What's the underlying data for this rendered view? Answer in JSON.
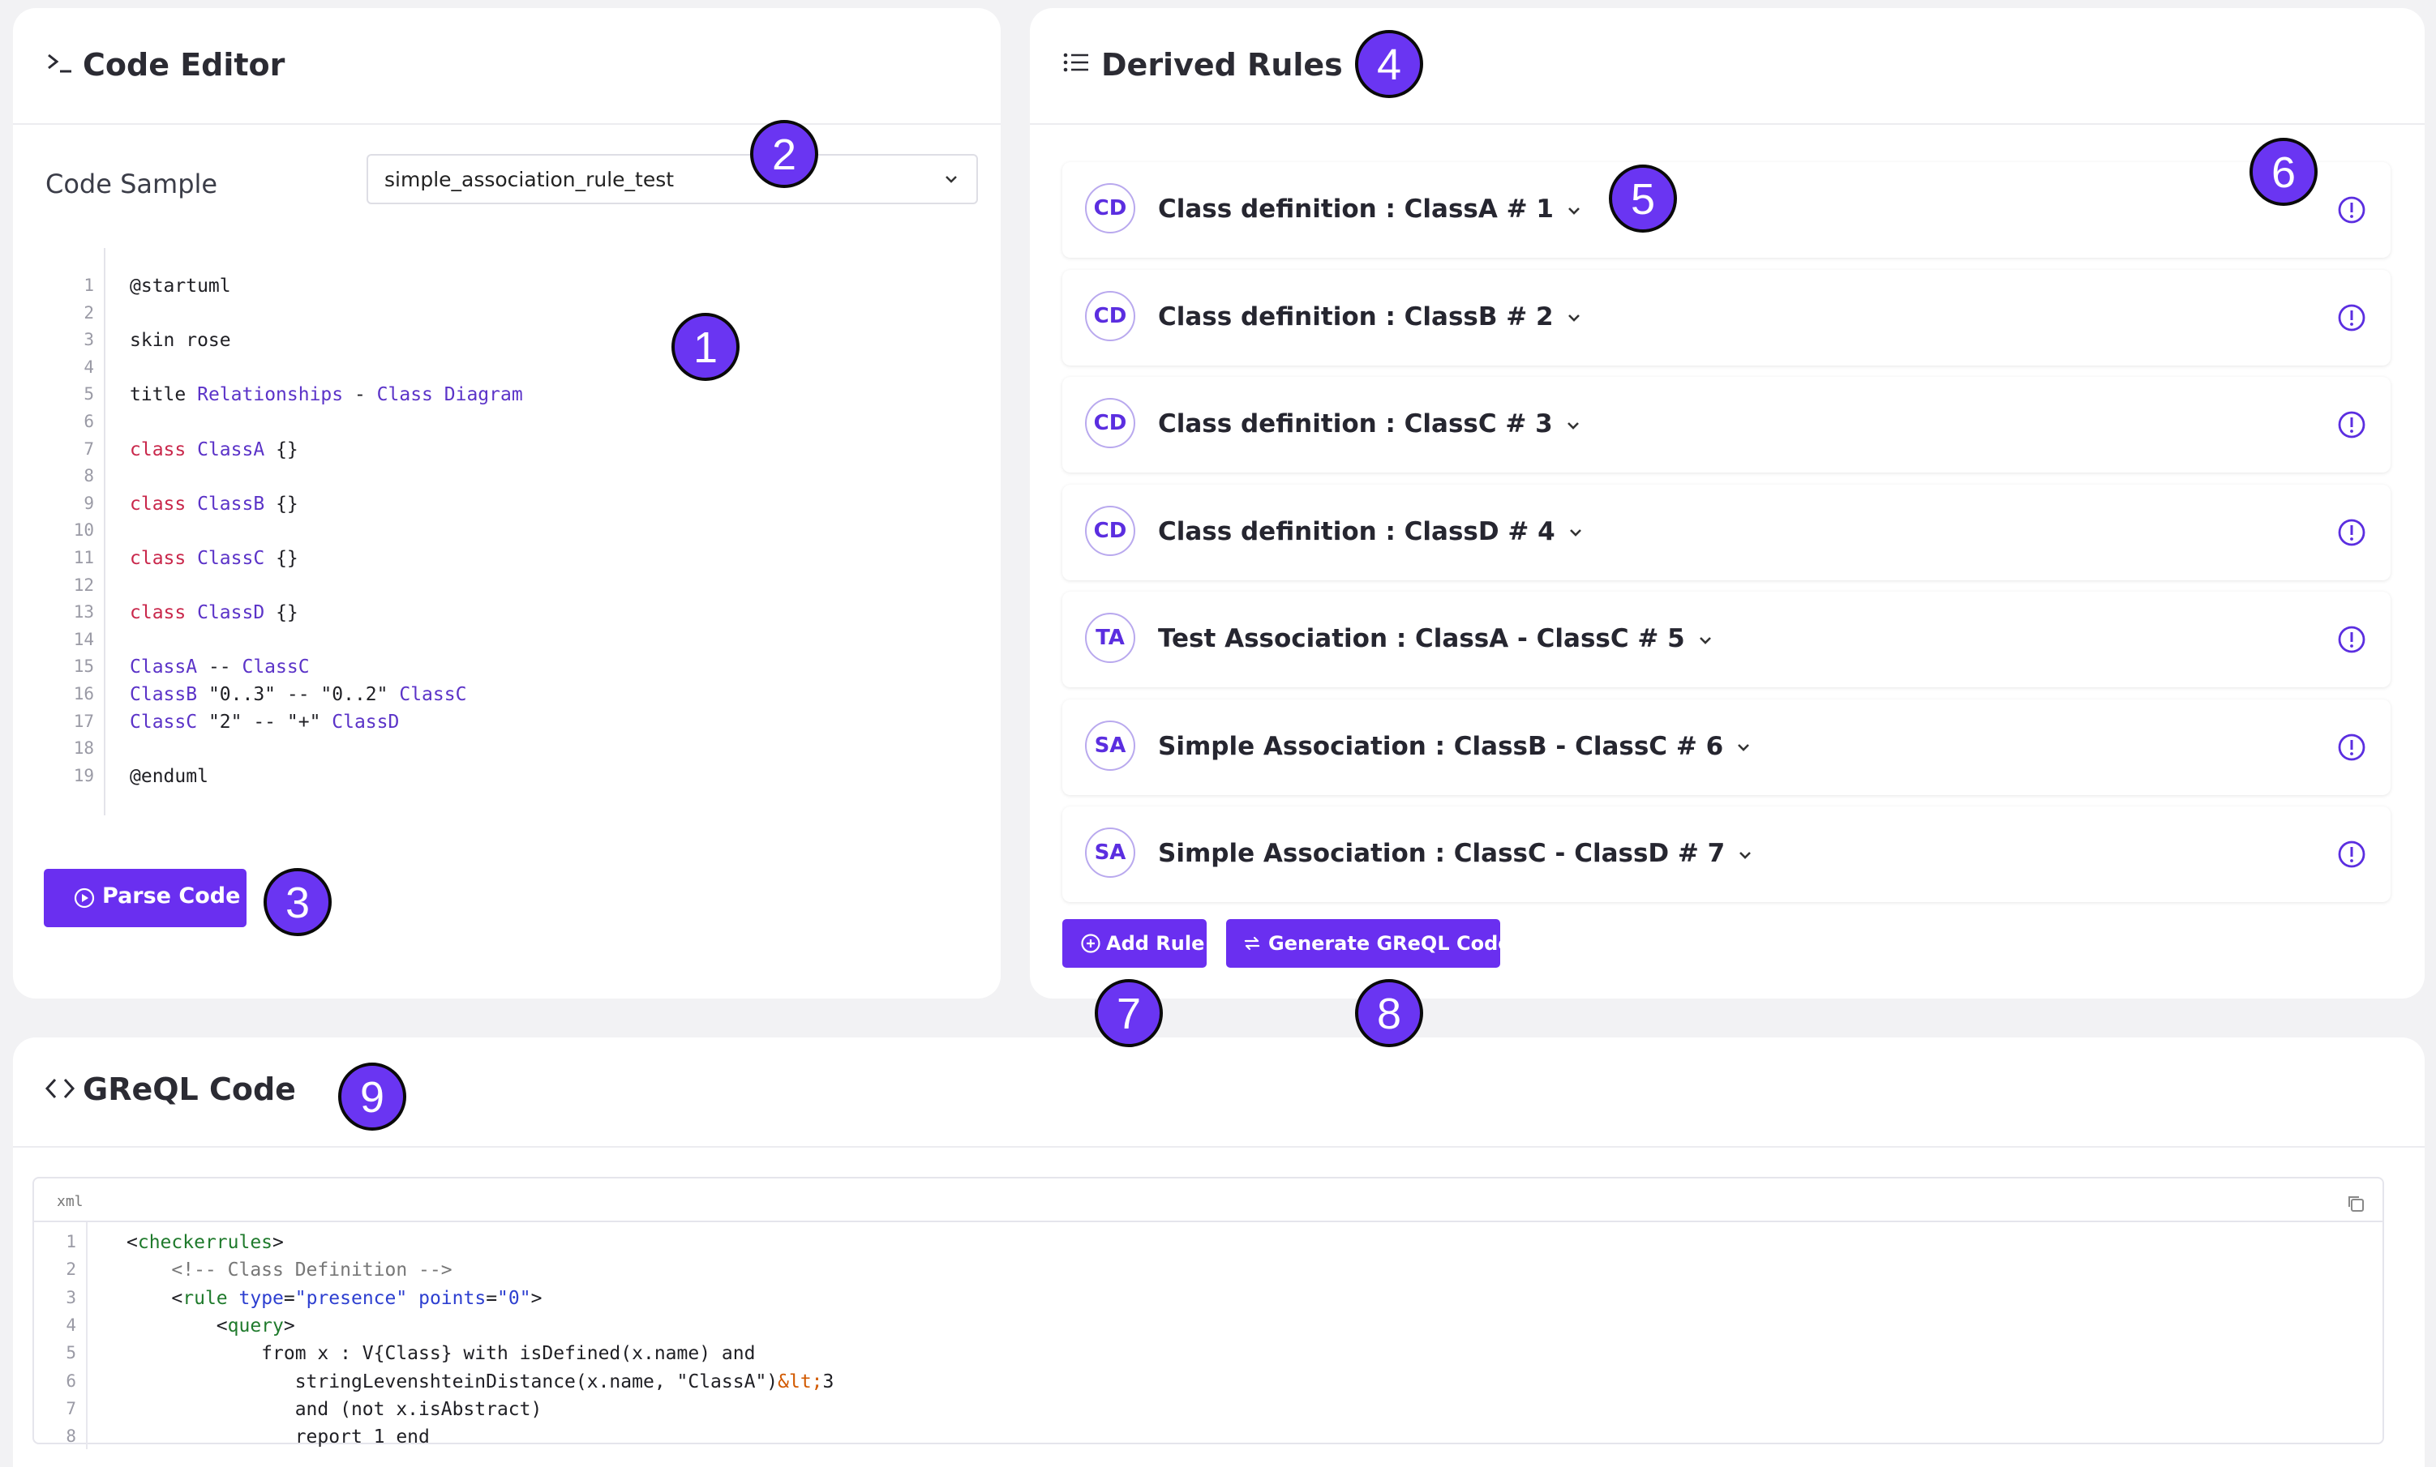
{
  "code_editor": {
    "title": "Code Editor",
    "sample_label": "Code Sample",
    "sample_value": "simple_association_rule_test",
    "lines": [
      {
        "n": "1",
        "t": "@startuml"
      },
      {
        "n": "2",
        "t": ""
      },
      {
        "n": "3",
        "t": "skin rose"
      },
      {
        "n": "4",
        "t": ""
      },
      {
        "n": "5",
        "t": "title Relationships - Class Diagram"
      },
      {
        "n": "6",
        "t": ""
      },
      {
        "n": "7",
        "t": "class ClassA {}"
      },
      {
        "n": "8",
        "t": ""
      },
      {
        "n": "9",
        "t": "class ClassB {}"
      },
      {
        "n": "10",
        "t": ""
      },
      {
        "n": "11",
        "t": "class ClassC {}"
      },
      {
        "n": "12",
        "t": ""
      },
      {
        "n": "13",
        "t": "class ClassD {}"
      },
      {
        "n": "14",
        "t": ""
      },
      {
        "n": "15",
        "t": "ClassA -- ClassC"
      },
      {
        "n": "16",
        "t": "ClassB \"0..3\" -- \"0..2\" ClassC"
      },
      {
        "n": "17",
        "t": "ClassC \"2\" -- \"+\" ClassD"
      },
      {
        "n": "18",
        "t": ""
      },
      {
        "n": "19",
        "t": "@enduml"
      }
    ],
    "parse_button": "Parse Code"
  },
  "derived_rules": {
    "title": "Derived Rules",
    "rules": [
      {
        "badge": "CD",
        "label": "Class definition : ClassA # 1"
      },
      {
        "badge": "CD",
        "label": "Class definition : ClassB # 2"
      },
      {
        "badge": "CD",
        "label": "Class definition : ClassC # 3"
      },
      {
        "badge": "CD",
        "label": "Class definition : ClassD # 4"
      },
      {
        "badge": "TA",
        "label": "Test Association : ClassA - ClassC # 5"
      },
      {
        "badge": "SA",
        "label": "Simple Association : ClassB - ClassC # 6"
      },
      {
        "badge": "SA",
        "label": "Simple Association : ClassC - ClassD # 7"
      }
    ],
    "add_button": "Add Rule",
    "generate_button": "Generate GReQL Code"
  },
  "greql": {
    "title": "GReQL Code",
    "lang": "xml",
    "line_numbers": [
      "1",
      "2",
      "3",
      "4",
      "5",
      "6",
      "7",
      "8"
    ],
    "lines": [
      "<checkerrules>",
      "    <!-- Class Definition -->",
      "    <rule type=\"presence\" points=\"0\">",
      "        <query>",
      "            from x : V{Class} with isDefined(x.name) and",
      "               stringLevenshteinDistance(x.name, \"ClassA\")&lt;3",
      "               and (not x.isAbstract)",
      "               report 1 end"
    ]
  },
  "callouts": [
    "1",
    "2",
    "3",
    "4",
    "5",
    "6",
    "7",
    "8",
    "9"
  ],
  "icons": {
    "code_editor": "terminal-icon",
    "derived_rules": "list-icon",
    "greql": "code-brackets-icon",
    "parse": "play-circle-icon",
    "add": "plus-circle-icon",
    "generate": "refresh-icon",
    "rule_info": "info-circle-icon",
    "copy": "copy-icon"
  },
  "colors": {
    "accent": "#6a2ff0",
    "callout_fill": "#6a35f2",
    "keyword": "#c9274b",
    "name": "#5b33c8"
  }
}
